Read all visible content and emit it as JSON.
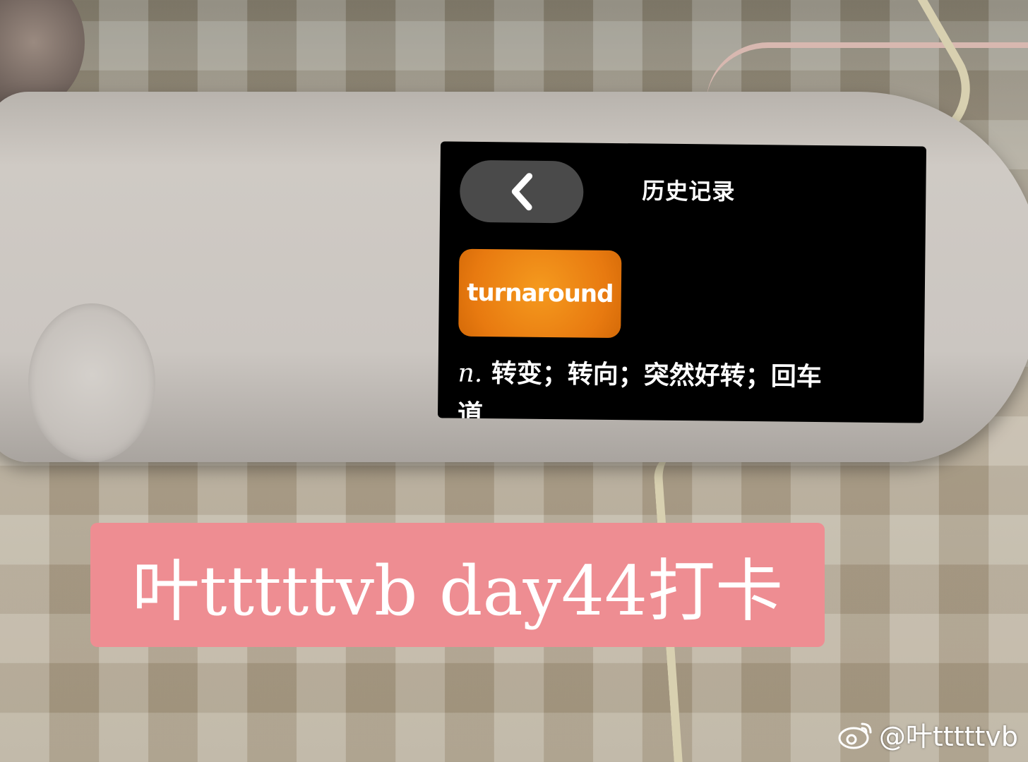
{
  "screen": {
    "back_icon": "chevron-left-icon",
    "title": "历史记录",
    "word": "turnaround",
    "definition_pos": "n.",
    "definition_text": "转变；转向；突然好转；回车",
    "definition_overflow": "道"
  },
  "caption": {
    "text": "叶tttttvb day44打卡",
    "background": "#ee8d92"
  },
  "watermark": {
    "icon": "weibo-logo-icon",
    "text": "@叶tttttvb"
  },
  "colors": {
    "screen_bg": "#000000",
    "back_button": "#4a4a4a",
    "word_chip": "#f08a18"
  }
}
